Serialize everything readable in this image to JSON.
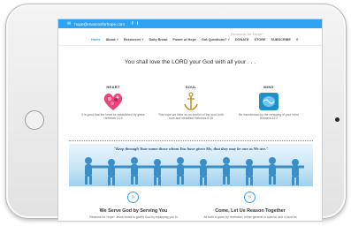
{
  "topbar": {
    "email": "hope@reasonsforhope.com",
    "facebook": "f",
    "twitter": "t"
  },
  "header": {
    "logo_text": "Reasons for Hope*",
    "nav": [
      "Home",
      "About",
      "Resources",
      "Daily Bread",
      "Power of Hope",
      "Got Questions?",
      "DONATE",
      "STORE",
      "SUBSCRIBE"
    ]
  },
  "main": {
    "headline": "You shall love the LORD your God with all your . . .",
    "columns": [
      {
        "title": "HEART",
        "desc": "It is good that the heart be established by grace Hebrews 13:9"
      },
      {
        "title": "SOUL",
        "desc": "This hope we have as an anchor of the soul, both sure and steadfast Hebrews 6:19"
      },
      {
        "title": "MIND",
        "desc": "Be transformed by the renewing of your mind Romans 12:2"
      }
    ],
    "banner_quote": "\"Keep through Your name those whom You have given Me, that they may be one as We are.\""
  },
  "bottom": {
    "left_heading": "We Serve God by Serving You",
    "left_text": "Reasons for Hope* Jesus exists to glorify God by equipping you to",
    "right_heading": "Come, Let Us Reason Together",
    "right_text": "All truth is given by revelation, either general or special, and it must be",
    "button_glyph": "»"
  },
  "colors": {
    "accent": "#2ea3f2"
  }
}
